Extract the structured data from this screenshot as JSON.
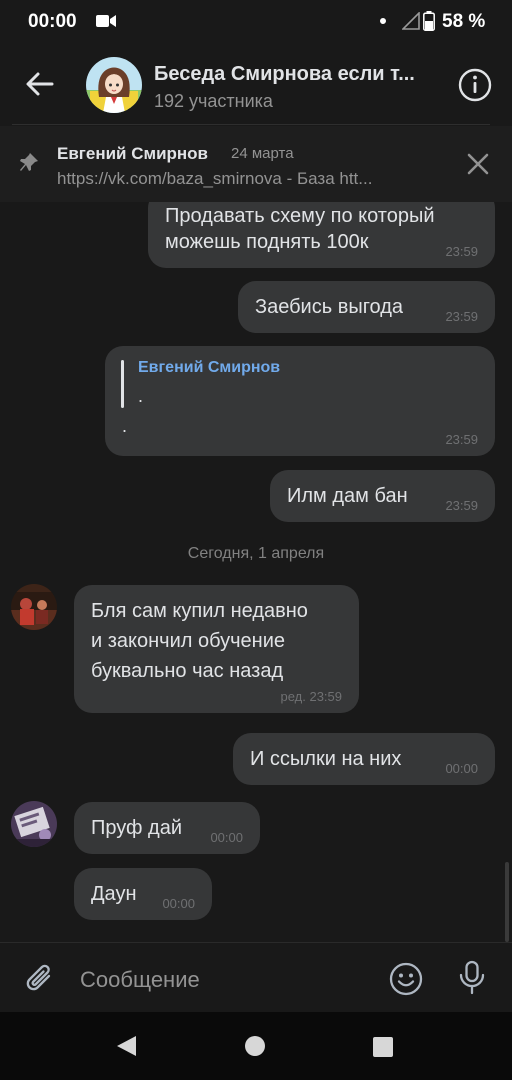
{
  "status_bar": {
    "time": "00:00",
    "battery_pct": "58 %"
  },
  "header": {
    "title": "Беседа Смирнова  если т...",
    "subtitle": "192 участника"
  },
  "pinned": {
    "author": "Евгений Смирнов",
    "date": "24 марта",
    "text": "https://vk.com/baza_smirnova - База htt..."
  },
  "messages": [
    {
      "direction": "out",
      "lines": [
        "Продавать схему по который",
        "можешь поднять 100к"
      ],
      "time": "23:59"
    },
    {
      "direction": "out",
      "lines": [
        "Заебись выгода"
      ],
      "time": "23:59"
    },
    {
      "direction": "out",
      "quote_author": "Евгений Смирнов",
      "quote_text": ".",
      "lines": [
        "."
      ],
      "time": "23:59"
    },
    {
      "direction": "out",
      "lines": [
        "Илм дам бан"
      ],
      "time": "23:59"
    },
    {
      "direction": "in",
      "lines": [
        "Бля сам купил недавно",
        "и закончил обучение",
        "буквально час назад"
      ],
      "time": "ред. 23:59"
    },
    {
      "direction": "out",
      "lines": [
        "И ссылки на них"
      ],
      "time": "00:00"
    },
    {
      "direction": "in",
      "lines": [
        "Пруф дай"
      ],
      "time": "00:00"
    },
    {
      "direction": "in",
      "lines": [
        "Даун"
      ],
      "time": "00:00"
    }
  ],
  "date_separator": "Сегодня, 1 апреля",
  "composer": {
    "placeholder": "Сообщение"
  },
  "colors": {
    "background": "#191919",
    "bubble": "#363738",
    "accent_link": "#71aaeb",
    "secondary_text": "#939393"
  },
  "icons": [
    "arrow-left-icon",
    "info-icon",
    "pin-icon",
    "close-icon",
    "paperclip-icon",
    "smile-icon",
    "microphone-icon",
    "nav-back-icon",
    "nav-home-icon",
    "nav-recent-icon",
    "video-record-icon",
    "signal-icon",
    "battery-icon"
  ]
}
